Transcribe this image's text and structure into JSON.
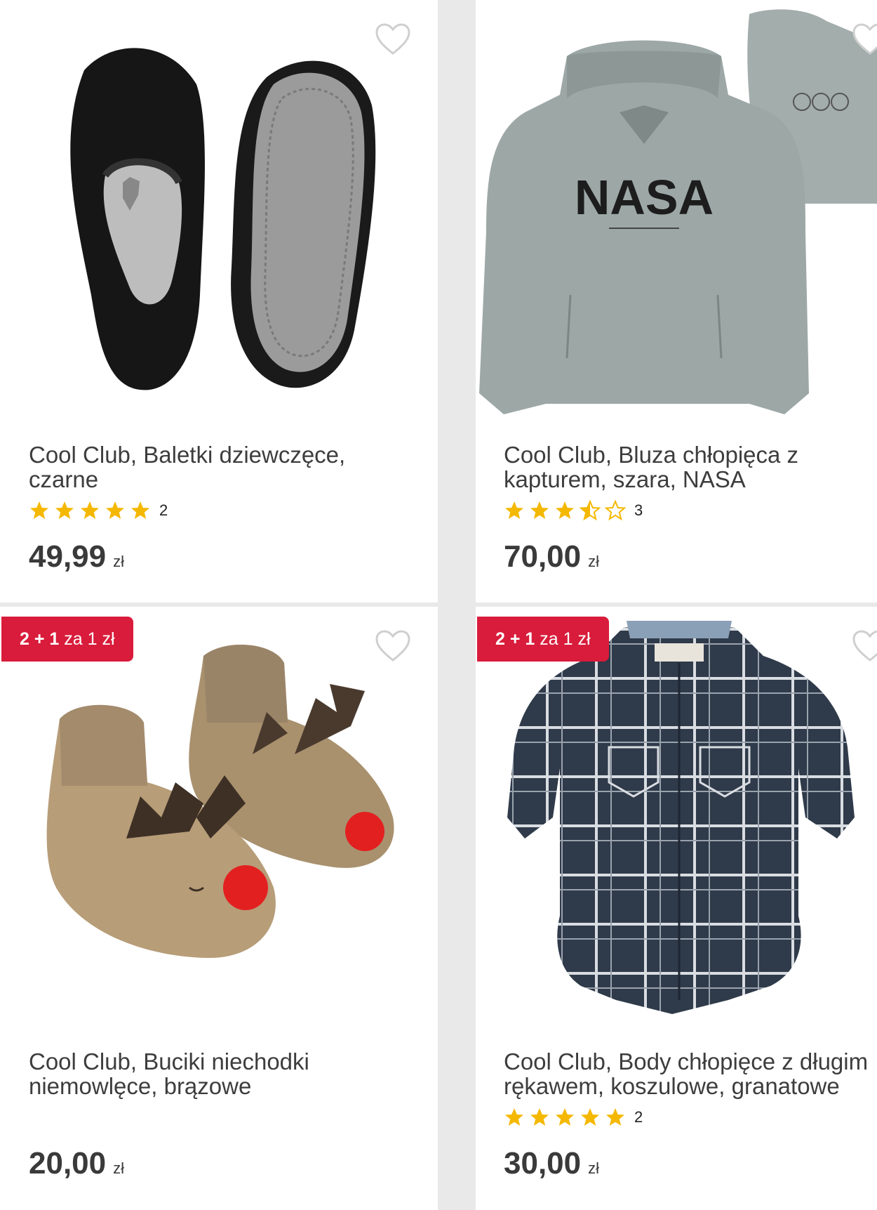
{
  "products": [
    {
      "name": "Cool Club, Baletki dziewczęce, czarne",
      "rating": 5,
      "rating_count": "2",
      "price": "49,99",
      "currency": "zł",
      "badge": "",
      "image": "black-ballet-slippers"
    },
    {
      "name": "Cool Club, Bluza chłopięca z kapturem, szara, NASA",
      "rating": 3.5,
      "rating_count": "3",
      "price": "70,00",
      "currency": "zł",
      "badge": "",
      "image": "grey-nasa-hoodie",
      "print_text": "NASA"
    },
    {
      "name": "Cool Club, Buciki niechodki niemowlęce, brązowe",
      "rating": null,
      "rating_count": "",
      "price": "20,00",
      "currency": "zł",
      "badge_bold": "2 + 1",
      "badge_rest": " za 1 zł",
      "image": "reindeer-baby-booties"
    },
    {
      "name": "Cool Club, Body chłopięce z długim rękawem, koszulowe, granatowe",
      "rating": 5,
      "rating_count": "2",
      "price": "30,00",
      "currency": "zł",
      "badge_bold": "2 + 1",
      "badge_rest": " za 1 zł",
      "image": "plaid-shirt-bodysuit"
    }
  ],
  "colors": {
    "star": "#f5b800",
    "badge": "#d91c3b",
    "heart": "#cfcfcf"
  },
  "icons": {
    "favorite": "heart-outline-icon",
    "rating": "star-icon"
  }
}
